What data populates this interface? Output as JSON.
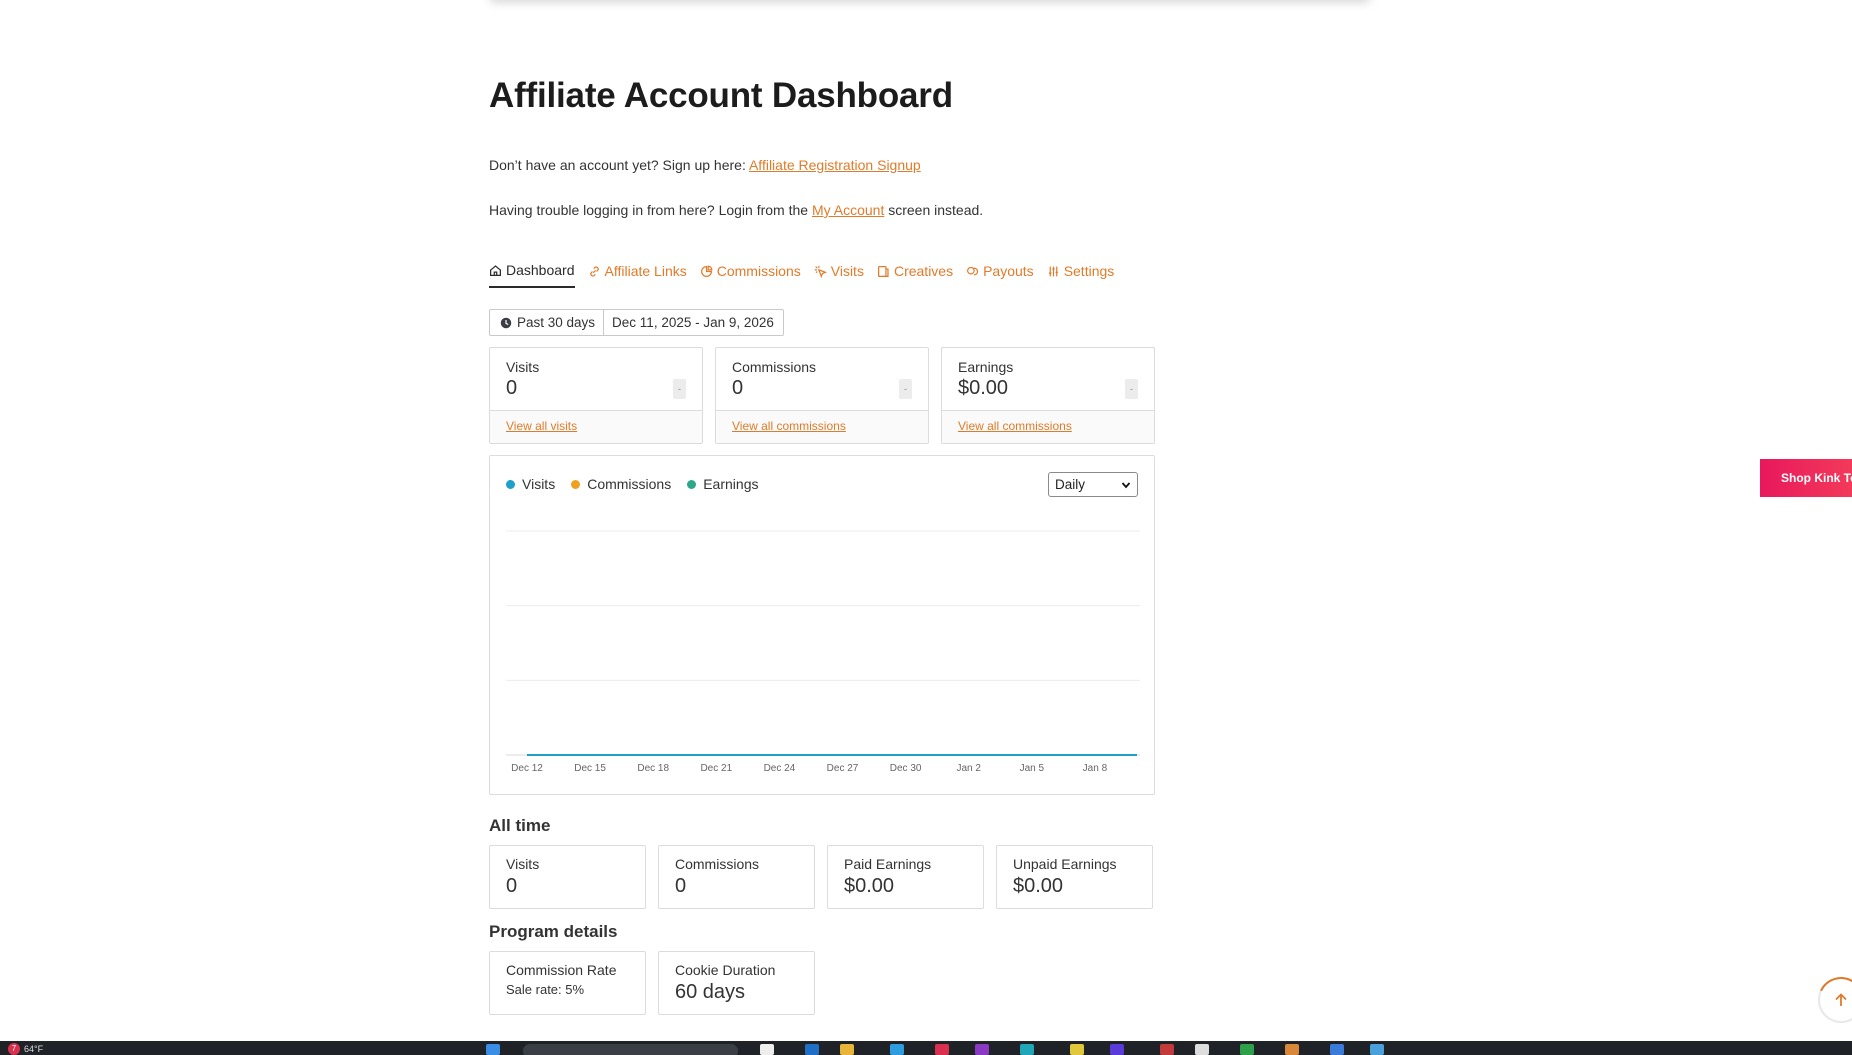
{
  "page": {
    "title": "Affiliate Account Dashboard",
    "signup_prefix": "Don’t have an account yet? Sign up here: ",
    "signup_link": "Affiliate Registration Signup",
    "login_prefix": "Having trouble logging in from here? Login from the ",
    "login_link": "My Account",
    "login_suffix": " screen instead."
  },
  "tabs": [
    {
      "label": "Dashboard",
      "icon": "home-icon",
      "active": true
    },
    {
      "label": "Affiliate Links",
      "icon": "link-icon"
    },
    {
      "label": "Commissions",
      "icon": "pie-chart-icon"
    },
    {
      "label": "Visits",
      "icon": "cursor-click-icon"
    },
    {
      "label": "Creatives",
      "icon": "image-icon"
    },
    {
      "label": "Payouts",
      "icon": "coins-icon"
    },
    {
      "label": "Settings",
      "icon": "sliders-icon"
    }
  ],
  "date_filter": {
    "preset": "Past 30 days",
    "range": "Dec 11, 2025 - Jan 9, 2026"
  },
  "stats": [
    {
      "label": "Visits",
      "value": "0",
      "delta": "-",
      "link": "View all visits"
    },
    {
      "label": "Commissions",
      "value": "0",
      "delta": "-",
      "link": "View all commissions"
    },
    {
      "label": "Earnings",
      "value": "$0.00",
      "delta": "-",
      "link": "View all commissions"
    }
  ],
  "chart": {
    "interval": "Daily"
  },
  "chart_data": {
    "type": "line",
    "x": [
      "Dec 12",
      "Dec 15",
      "Dec 18",
      "Dec 21",
      "Dec 24",
      "Dec 27",
      "Dec 30",
      "Jan 2",
      "Jan 5",
      "Jan 8"
    ],
    "series": [
      {
        "name": "Visits",
        "color": "#1ea1c9",
        "values": [
          0,
          0,
          0,
          0,
          0,
          0,
          0,
          0,
          0,
          0
        ]
      },
      {
        "name": "Commissions",
        "color": "#f0a020",
        "values": [
          0,
          0,
          0,
          0,
          0,
          0,
          0,
          0,
          0,
          0
        ]
      },
      {
        "name": "Earnings",
        "color": "#2aa889",
        "values": [
          0,
          0,
          0,
          0,
          0,
          0,
          0,
          0,
          0,
          0
        ]
      }
    ],
    "ylim": [
      0,
      3
    ],
    "grid": true,
    "legend": "top-left"
  },
  "all_time": {
    "title": "All time",
    "cards": [
      {
        "label": "Visits",
        "value": "0"
      },
      {
        "label": "Commissions",
        "value": "0"
      },
      {
        "label": "Paid Earnings",
        "value": "$0.00"
      },
      {
        "label": "Unpaid Earnings",
        "value": "$0.00"
      }
    ]
  },
  "program": {
    "title": "Program details",
    "commission_label": "Commission Rate",
    "commission_value": "Sale rate: 5%",
    "cookie_label": "Cookie Duration",
    "cookie_value": "60 days"
  },
  "side_tab": "Shop Kink To",
  "taskbar": {
    "weather_badge": "7",
    "weather_temp": "64°F"
  },
  "colors": {
    "accent": "#e07b2a",
    "shop_tab": "#e8185c"
  }
}
